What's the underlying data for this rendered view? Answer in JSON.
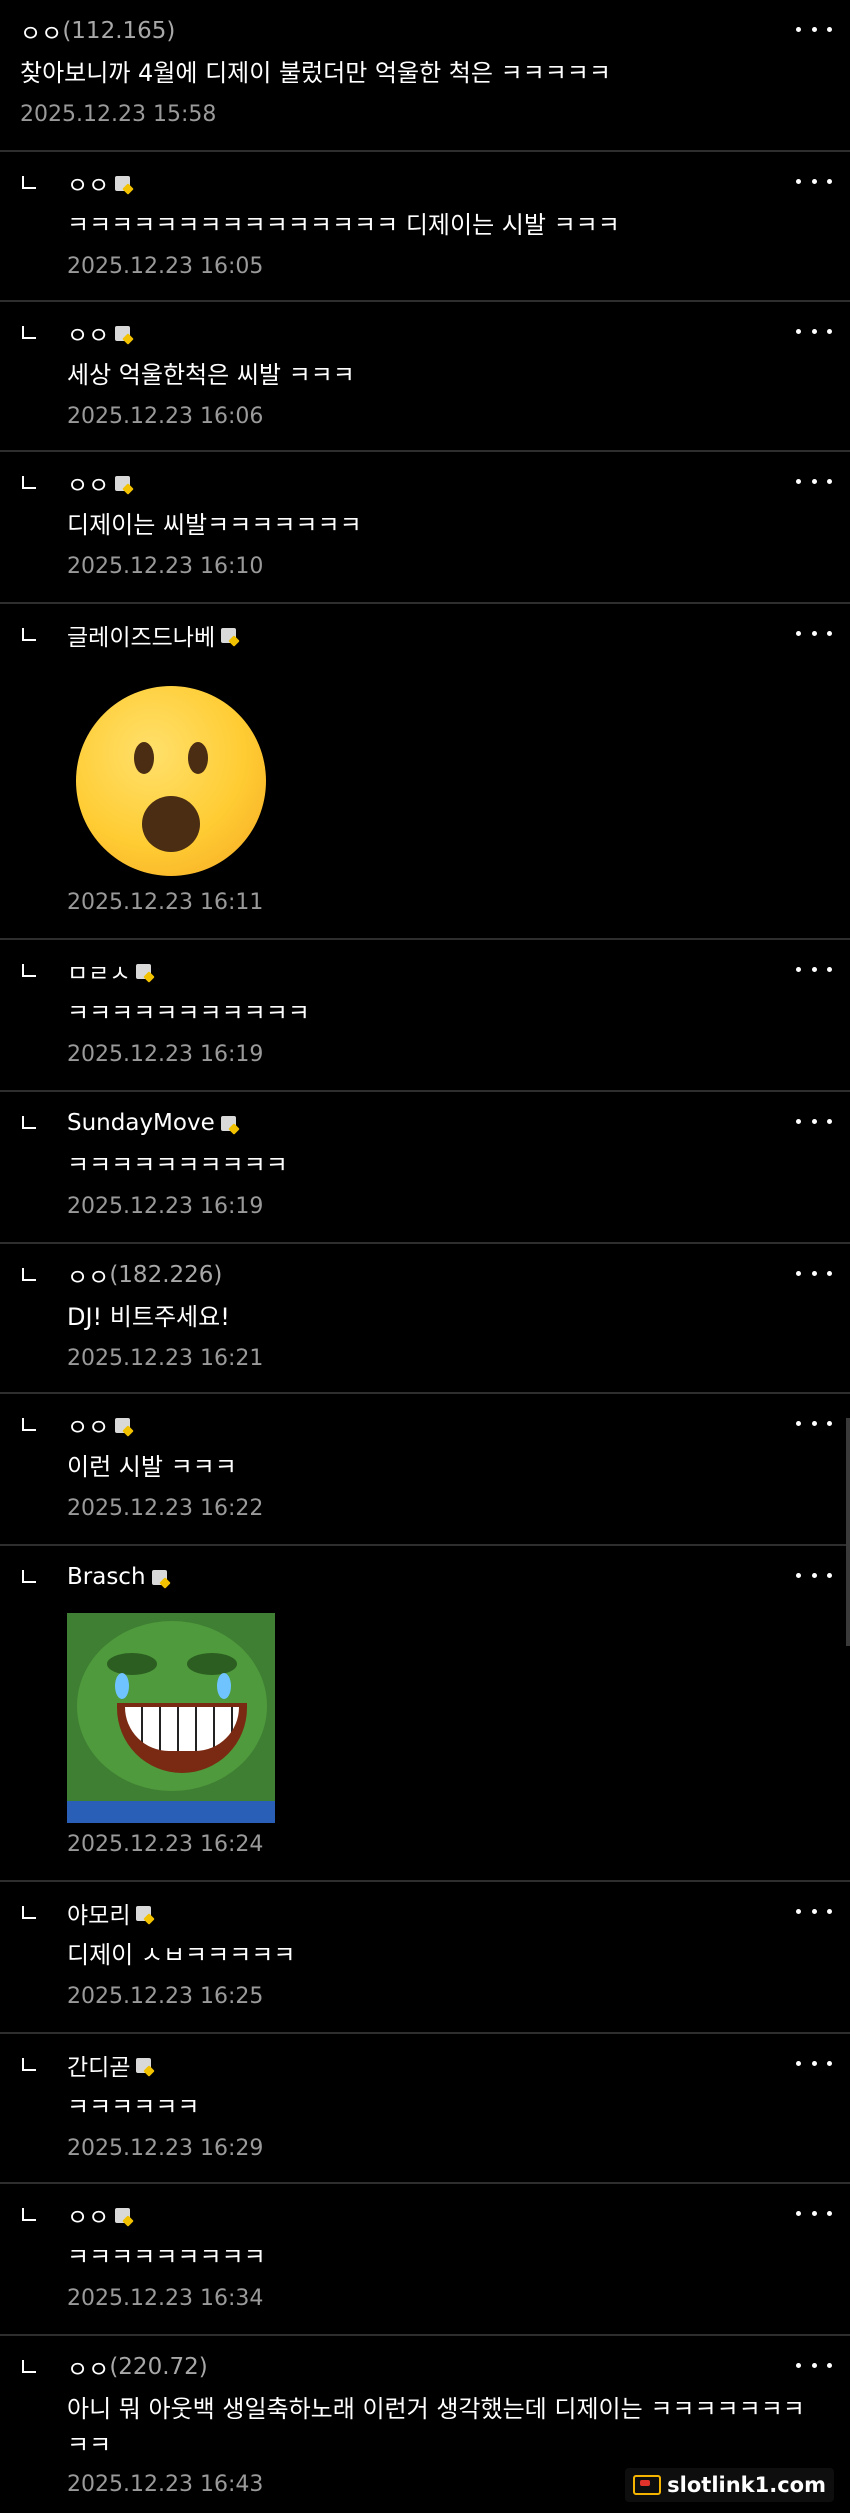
{
  "comments": [
    {
      "nick": "ㅇㅇ",
      "ip": "(112.165)",
      "text": "찾아보니까 4월에 디제이 불렀더만 억울한 척은 ㅋㅋㅋㅋㅋ",
      "date": "2025.12.23 15:58",
      "reply": false,
      "badge": false
    },
    {
      "nick": "ㅇㅇ",
      "ip": "",
      "text": "ㅋㅋㅋㅋㅋㅋㅋㅋㅋㅋㅋㅋㅋㅋㅋ 디제이는 시발 ㅋㅋㅋ",
      "date": "2025.12.23 16:05",
      "reply": true,
      "badge": true
    },
    {
      "nick": "ㅇㅇ",
      "ip": "",
      "text": "세상 억울한척은 씨발 ㅋㅋㅋ",
      "date": "2025.12.23 16:06",
      "reply": true,
      "badge": true
    },
    {
      "nick": "ㅇㅇ",
      "ip": "",
      "text": "디제이는 씨발ㅋㅋㅋㅋㅋㅋㅋ",
      "date": "2025.12.23 16:10",
      "reply": true,
      "badge": true
    },
    {
      "nick": "글레이즈드나베",
      "ip": "",
      "text": "",
      "date": "2025.12.23 16:11",
      "reply": true,
      "badge": true,
      "image": "astonished-face-emoji"
    },
    {
      "nick": "ㅁㄹㅅ",
      "ip": "",
      "text": "ㅋㅋㅋㅋㅋㅋㅋㅋㅋㅋㅋ",
      "date": "2025.12.23 16:19",
      "reply": true,
      "badge": true
    },
    {
      "nick": "SundayMove",
      "ip": "",
      "text": "ㅋㅋㅋㅋㅋㅋㅋㅋㅋㅋ",
      "date": "2025.12.23 16:19",
      "reply": true,
      "badge": true
    },
    {
      "nick": "ㅇㅇ",
      "ip": "(182.226)",
      "text": "DJ! 비트주세요!",
      "date": "2025.12.23 16:21",
      "reply": true,
      "badge": false
    },
    {
      "nick": "ㅇㅇ",
      "ip": "",
      "text": "이런 시발 ㅋㅋㅋ",
      "date": "2025.12.23 16:22",
      "reply": true,
      "badge": true
    },
    {
      "nick": "Brasch",
      "ip": "",
      "text": "",
      "date": "2025.12.23 16:24",
      "reply": true,
      "badge": true,
      "image": "laughing-pepe-frog"
    },
    {
      "nick": "야모리",
      "ip": "",
      "text": "디제이 ㅅㅂㅋㅋㅋㅋㅋ",
      "date": "2025.12.23 16:25",
      "reply": true,
      "badge": true
    },
    {
      "nick": "간디곧",
      "ip": "",
      "text": "ㅋㅋㅋㅋㅋㅋ",
      "date": "2025.12.23 16:29",
      "reply": true,
      "badge": true
    },
    {
      "nick": "ㅇㅇ",
      "ip": "",
      "text": "ㅋㅋㅋㅋㅋㅋㅋㅋㅋ",
      "date": "2025.12.23 16:34",
      "reply": true,
      "badge": true
    },
    {
      "nick": "ㅇㅇ",
      "ip": "(220.72)",
      "text": "아니 뭐 아웃백 생일축하노래 이런거 생각했는데 디제이는 ㅋㅋㅋㅋㅋㅋㅋ",
      "text2": "ㅋㅋ",
      "date": "2025.12.23 16:43",
      "reply": true,
      "badge": false
    }
  ],
  "watermark": {
    "label": "slotlink1.com"
  }
}
